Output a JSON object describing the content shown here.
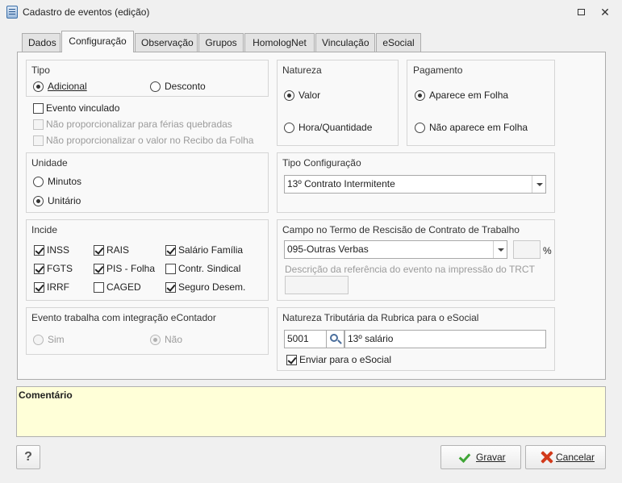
{
  "window": {
    "title": "Cadastro de eventos (edição)"
  },
  "tabs": [
    "Dados",
    "Configuração",
    "Observação",
    "Grupos",
    "HomologNet",
    "Vinculação",
    "eSocial"
  ],
  "tipo": {
    "label": "Tipo",
    "options": [
      "Adicional",
      "Desconto"
    ],
    "selected": "Adicional",
    "evento_vinculado": "Evento vinculado",
    "nao_prop_ferias": "Não proporcionalizar para férias quebradas",
    "nao_prop_recibo": "Não proporcionalizar o valor no Recibo da Folha"
  },
  "natureza": {
    "label": "Natureza",
    "options": [
      "Valor",
      "Hora/Quantidade"
    ],
    "selected": "Valor"
  },
  "pagamento": {
    "label": "Pagamento",
    "options": [
      "Aparece em Folha",
      "Não aparece em Folha"
    ],
    "selected": "Aparece em Folha"
  },
  "unidade": {
    "label": "Unidade",
    "options": [
      "Minutos",
      "Unitário"
    ],
    "selected": "Unitário"
  },
  "tipo_configuracao": {
    "label": "Tipo Configuração",
    "value": "13º Contrato Intermitente"
  },
  "incide": {
    "label": "Incide",
    "items": [
      {
        "label": "INSS",
        "checked": true
      },
      {
        "label": "RAIS",
        "checked": true
      },
      {
        "label": "Salário Família",
        "checked": true
      },
      {
        "label": "FGTS",
        "checked": true
      },
      {
        "label": "PIS - Folha",
        "checked": true
      },
      {
        "label": "Contr. Sindical",
        "checked": false
      },
      {
        "label": "IRRF",
        "checked": true
      },
      {
        "label": "CAGED",
        "checked": false
      },
      {
        "label": "Seguro Desem.",
        "checked": true
      }
    ]
  },
  "campo_termo": {
    "label": "Campo no Termo de Rescisão de Contrato de Trabalho",
    "value": "095-Outras Verbas",
    "percent_symbol": "%",
    "descricao_label": "Descrição da referência do evento na impressão do TRCT",
    "descricao_value": ""
  },
  "econtador": {
    "label": "Evento trabalha com integração eContador",
    "options": [
      "Sim",
      "Não"
    ],
    "selected": "Não"
  },
  "natureza_tributaria": {
    "label": "Natureza Tributária da Rubrica para o eSocial",
    "code": "5001",
    "description": "13º salário",
    "enviar_label": "Enviar para o eSocial",
    "enviar_checked": true
  },
  "comentario": {
    "label": "Comentário"
  },
  "buttons": {
    "help": "?",
    "gravar": "Gravar",
    "cancelar": "Cancelar"
  }
}
